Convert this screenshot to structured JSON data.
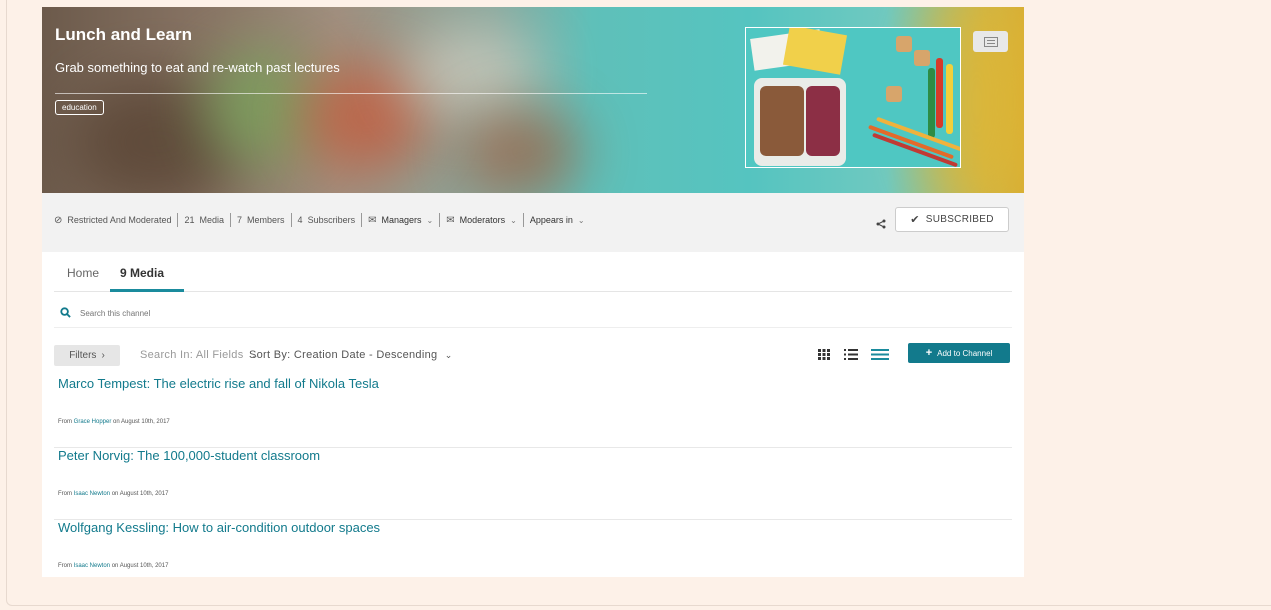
{
  "channel": {
    "title": "Lunch and Learn",
    "description": "Grab something to eat and re-watch past lectures",
    "tag": "education"
  },
  "meta": {
    "restriction": "Restricted And Moderated",
    "media_count": "21",
    "media_label": "Media",
    "members_count": "7",
    "members_label": "Members",
    "subscribers_count": "4",
    "subscribers_label": "Subscribers",
    "managers": "Managers",
    "moderators": "Moderators",
    "appears_in": "Appears in",
    "subscribed": "SUBSCRIBED"
  },
  "tabs": [
    {
      "label": "Home",
      "active": false
    },
    {
      "label": "9 Media",
      "active": true
    }
  ],
  "search": {
    "placeholder": "Search this channel"
  },
  "toolbar": {
    "filters": "Filters",
    "search_in": "Search In: All Fields",
    "sort_by": "Sort By: Creation Date - Descending",
    "add_to_channel": "Add to Channel"
  },
  "media": [
    {
      "title": "Marco Tempest: The electric rise and fall of Nikola Tesla",
      "from": "From",
      "user": "Grace Hopper",
      "date": "on August 10th, 2017"
    },
    {
      "title": "Peter Norvig: The 100,000-student classroom",
      "from": "From",
      "user": "Isaac Newton",
      "date": "on August 10th, 2017"
    },
    {
      "title": "Wolfgang Kessling: How to air-condition outdoor spaces",
      "from": "From",
      "user": "Isaac Newton",
      "date": "on August 10th, 2017"
    }
  ],
  "icons": {
    "restricted": "prohibited-icon",
    "managers": "envelope-icon",
    "moderators": "envelope-icon",
    "share": "share-icon",
    "subscribed": "check-icon",
    "search": "search-icon",
    "grid_view": "grid-view-icon",
    "list_view": "list-view-icon",
    "compact_view": "compact-list-icon",
    "add": "plus-icon"
  },
  "colors": {
    "accent": "#127a8c",
    "tab_underline": "#1a8b9d",
    "page_background": "#fdf1e8"
  }
}
